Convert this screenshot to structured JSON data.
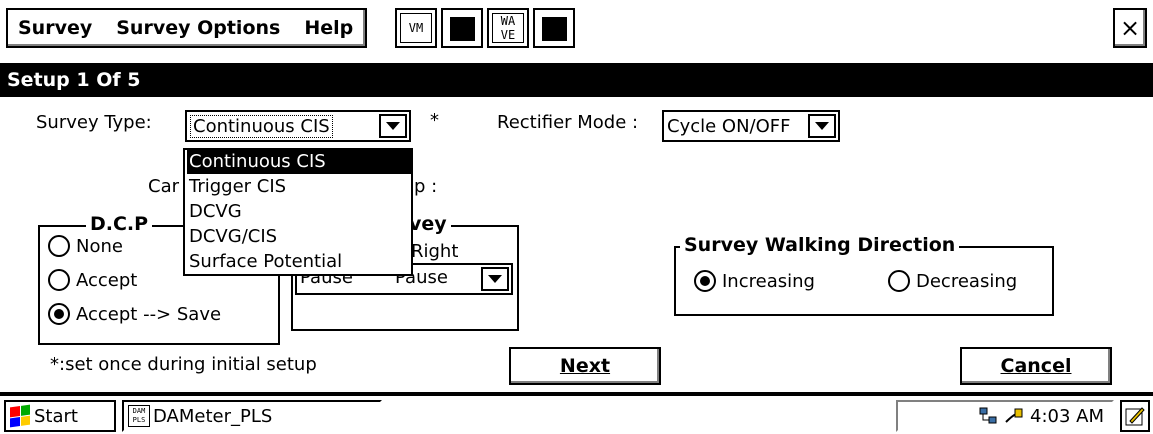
{
  "menubar": {
    "items": [
      {
        "label": "Survey"
      },
      {
        "label": "Survey Options"
      },
      {
        "label": "Help"
      }
    ],
    "toolbar": {
      "vm": "VM",
      "wave_top": "WA",
      "wave_bottom": "VE"
    },
    "close": "×"
  },
  "title": "Setup 1 Of 5",
  "form": {
    "survey_type_label": "Survey Type:",
    "survey_type_value": "Continuous CIS",
    "asterisk": "*",
    "rectifier_label": "Rectifier Mode :",
    "rectifier_value": "Cycle ON/OFF",
    "hidden_label_fragment_left": "Car",
    "hidden_label_fragment_right": "p :",
    "survey_type_options": [
      "Continuous CIS",
      "Trigger CIS",
      "DCVG",
      "DCVG/CIS",
      "Surface Potential"
    ],
    "survey_type_selected_index": 0
  },
  "dcp_group": {
    "legend_visible": "D.C.P",
    "options": [
      {
        "label": "None",
        "checked": false
      },
      {
        "label": "Accept",
        "checked": false
      },
      {
        "label": "Accept --> Save",
        "checked": true
      }
    ]
  },
  "survey_group": {
    "legend_visible": "vey",
    "right_label": "Right",
    "combo_left": "Pause",
    "combo_right": "Pause"
  },
  "walking_group": {
    "legend": "Survey Walking Direction",
    "options": [
      {
        "label": "Increasing",
        "checked": true
      },
      {
        "label": "Decreasing",
        "checked": false
      }
    ]
  },
  "footer": {
    "note": "*:set once during initial setup",
    "next_label": "Next",
    "cancel_label": "Cancel"
  },
  "taskbar": {
    "start": "Start",
    "app_icon_top": "DAM",
    "app_icon_bottom": "PLS",
    "app": "DAMeter_PLS",
    "time": "4:03 AM"
  }
}
